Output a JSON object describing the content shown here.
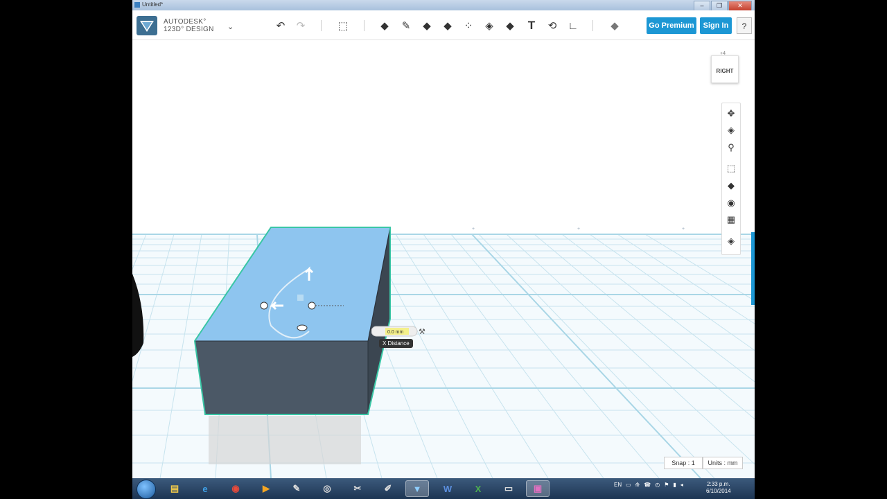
{
  "window": {
    "title": "Untitled*",
    "min": "–",
    "max": "❐",
    "close": "✕"
  },
  "brand": {
    "line1": "AUTODESK°",
    "line2": "123D° DESIGN",
    "menu_caret": "⌄"
  },
  "toolbar": {
    "undo": "↶",
    "redo": "↷",
    "tools": [
      {
        "name": "transform-icon",
        "glyph": "⬚"
      },
      {
        "name": "primitives-icon",
        "glyph": "◆"
      },
      {
        "name": "sketch-icon",
        "glyph": "✎"
      },
      {
        "name": "construct-icon",
        "glyph": "◆"
      },
      {
        "name": "modify-icon",
        "glyph": "◆"
      },
      {
        "name": "pattern-icon",
        "glyph": "⁘"
      },
      {
        "name": "grouping-icon",
        "glyph": "◈"
      },
      {
        "name": "combine-icon",
        "glyph": "◆"
      },
      {
        "name": "text-icon",
        "glyph": "T"
      },
      {
        "name": "snap-icon",
        "glyph": "⟲"
      },
      {
        "name": "measure-icon",
        "glyph": "∟"
      },
      {
        "name": "material-icon",
        "glyph": "◆"
      }
    ],
    "go_premium": "Go Premium",
    "sign_in": "Sign In",
    "help": "?"
  },
  "viewcube": {
    "face": "RIGHT"
  },
  "grid_labels": {
    "top_hint": "+4"
  },
  "nav": {
    "items": [
      "pan-icon",
      "orbit-icon",
      "zoom-icon",
      "fit-icon",
      "view-cube-icon",
      "visibility-icon",
      "material-view-icon",
      "snap-view-icon"
    ]
  },
  "x_distance": {
    "label": "X Distance",
    "value": "0.0 mm"
  },
  "status": {
    "snap": "Snap : 1",
    "units": "Units : mm"
  },
  "taskbar": {
    "lang": "EN",
    "time": "2:33 p.m.",
    "date": "6/10/2014",
    "apps": [
      "explorer",
      "internet-explorer",
      "chrome",
      "media-player",
      "paint",
      "disk-utility",
      "paint-tool",
      "utility",
      "123d-design",
      "word",
      "excel",
      "projector",
      "presentation"
    ]
  },
  "colors": {
    "accent": "#1c97d4",
    "box_top": "#8ec5ef",
    "box_side": "#4e5c6c",
    "grid": "#cfe7f1"
  }
}
